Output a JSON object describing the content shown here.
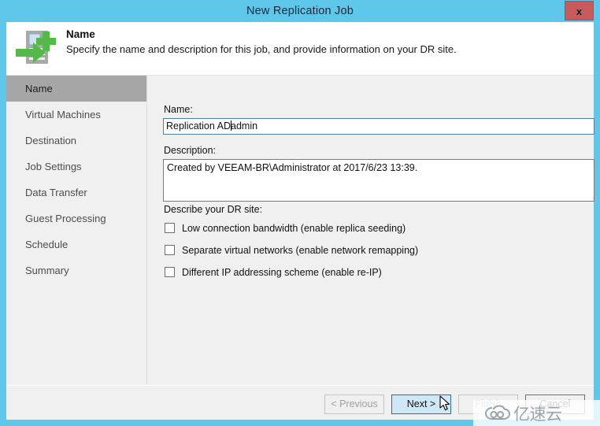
{
  "window": {
    "title": "New Replication Job",
    "close_label": "x",
    "frame_color": "#5ec7ea"
  },
  "header": {
    "icon": "replication-job-icon",
    "title": "Name",
    "subtitle": "Specify the name and description for this job, and provide information on your DR site."
  },
  "sidebar": {
    "items": [
      {
        "label": "Name",
        "active": true
      },
      {
        "label": "Virtual Machines",
        "active": false
      },
      {
        "label": "Destination",
        "active": false
      },
      {
        "label": "Job Settings",
        "active": false
      },
      {
        "label": "Data Transfer",
        "active": false
      },
      {
        "label": "Guest Processing",
        "active": false
      },
      {
        "label": "Schedule",
        "active": false
      },
      {
        "label": "Summary",
        "active": false
      }
    ],
    "active_highlight_color": "#a6a6a6"
  },
  "form": {
    "name_label": "Name:",
    "name_value_before_caret": "Replication AD",
    "name_value_after_caret": "admin",
    "name_value": "Replication ADadmin",
    "description_label": "Description:",
    "description_value": "Created by VEEAM-BR\\Administrator at 2017/6/23 13:39.",
    "describe_label": "Describe your DR site:",
    "checkboxes": [
      {
        "label": "Low connection bandwidth (enable replica seeding)",
        "checked": false
      },
      {
        "label": "Separate virtual networks (enable network remapping)",
        "checked": false
      },
      {
        "label": "Different IP addressing scheme (enable re-IP)",
        "checked": false
      }
    ]
  },
  "footer": {
    "buttons": [
      {
        "id": "previous",
        "label": "< Previous",
        "state": "disabled"
      },
      {
        "id": "next",
        "label": "Next >",
        "state": "focused"
      },
      {
        "id": "finish",
        "label": "Finish",
        "state": "disabled"
      },
      {
        "id": "cancel",
        "label": "Cancel",
        "state": "enabled"
      }
    ]
  },
  "watermark": {
    "text": "亿速云",
    "logo": "cloud-infinity-icon"
  }
}
